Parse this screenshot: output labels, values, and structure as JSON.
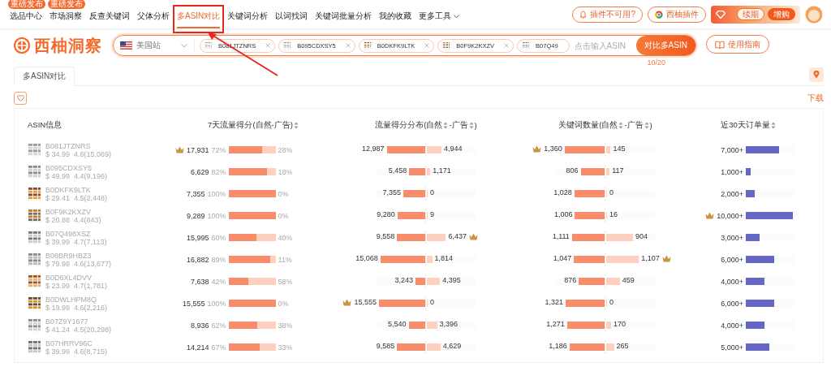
{
  "nav": {
    "items": [
      {
        "label": "选品中心",
        "badge": "重磅发布",
        "selected": false
      },
      {
        "label": "市场洞察",
        "badge": "重磅发布",
        "selected": false
      },
      {
        "label": "反查关键词",
        "selected": false
      },
      {
        "label": "父体分析",
        "selected": false
      },
      {
        "label": "多ASIN对比",
        "selected": true
      },
      {
        "label": "关键词分析",
        "selected": false
      },
      {
        "label": "以词找词",
        "selected": false
      },
      {
        "label": "关键词批量分析",
        "selected": false
      },
      {
        "label": "我的收藏",
        "selected": false
      },
      {
        "label": "更多工具",
        "dropdown": true,
        "selected": false
      }
    ],
    "actions": [
      {
        "kind": "alert",
        "label": "插件不可用?"
      },
      {
        "kind": "plugin",
        "label": "西柚插件"
      }
    ],
    "vip": {
      "renew": "续期",
      "buy": "增购"
    }
  },
  "brand": {
    "name": "西柚洞察"
  },
  "search": {
    "site": "美国站",
    "chips": [
      {
        "asin": "B081JTZNRS",
        "removable": true
      },
      {
        "asin": "B095CDXSY5",
        "removable": true
      },
      {
        "asin": "B0DKFK9LTK",
        "removable": true
      },
      {
        "asin": "B0F9K2KXZV",
        "removable": true
      },
      {
        "asin": "B07Q49",
        "removable": false
      }
    ],
    "placeholder": "点击输入ASIN",
    "button": "对比多ASIN",
    "count": "10/20"
  },
  "guide_button": "使用指南",
  "tabs": [
    {
      "label": "多ASIN对比",
      "selected": true
    }
  ],
  "download": "下载",
  "table": {
    "columns": [
      {
        "parts": [
          {
            "text": "ASIN信息"
          }
        ]
      },
      {
        "parts": [
          {
            "text": "7天流量得分(自然-广告)",
            "sortable": true
          }
        ]
      },
      {
        "parts": [
          {
            "text": "流量得分分布(自然",
            "sortable": true
          },
          {
            "text": "-广告",
            "sortable": true
          },
          {
            "text": ")"
          }
        ]
      },
      {
        "parts": [
          {
            "text": "关键词数量(自然",
            "sortable": true
          },
          {
            "text": "-广告",
            "sortable": true
          },
          {
            "text": ")"
          }
        ]
      },
      {
        "parts": [
          {
            "text": "近30天订单量",
            "sortable": true
          }
        ]
      }
    ],
    "rows": [
      {
        "asin": "B081JTZNRS",
        "price": "$ 34.99",
        "rating": "4.6(15,069)",
        "score": {
          "value": "17,931",
          "crown": true,
          "organic_pct": "72%",
          "ad_pct": "28%",
          "level": 0.72
        },
        "dist": {
          "organic": {
            "value": "12,987",
            "level": 0.79,
            "crown": false
          },
          "ad": {
            "value": "4,944",
            "level": 0.3,
            "crown": false
          }
        },
        "keywords": {
          "organic": {
            "value": "1,360",
            "level": 0.82,
            "crown": true
          },
          "ad": {
            "value": "145",
            "level": 0.09,
            "crown": false
          }
        },
        "orders": {
          "value": "7,000+",
          "level": 0.68,
          "crown": false
        }
      },
      {
        "asin": "B095CDXSY5",
        "price": "$ 49.99",
        "rating": "4.4(9,196)",
        "score": {
          "value": "6,629",
          "crown": false,
          "organic_pct": "82%",
          "ad_pct": "18%",
          "level": 0.82
        },
        "dist": {
          "organic": {
            "value": "5,458",
            "level": 0.33,
            "crown": false
          },
          "ad": {
            "value": "1,171",
            "level": 0.07,
            "crown": false
          }
        },
        "keywords": {
          "organic": {
            "value": "806",
            "level": 0.49,
            "crown": false
          },
          "ad": {
            "value": "117",
            "level": 0.07,
            "crown": false
          }
        },
        "orders": {
          "value": "1,000+",
          "level": 0.1,
          "crown": false
        }
      },
      {
        "asin": "B0DKFK9LTK",
        "price": "$ 29.41",
        "rating": "4.5(2,448)",
        "score": {
          "value": "7,355",
          "crown": false,
          "organic_pct": "100%",
          "ad_pct": "0%",
          "level": 1
        },
        "dist": {
          "organic": {
            "value": "7,355",
            "level": 0.45,
            "crown": false
          },
          "ad": {
            "value": "0",
            "level": 0,
            "crown": false
          }
        },
        "keywords": {
          "organic": {
            "value": "1,028",
            "level": 0.62,
            "crown": false
          },
          "ad": {
            "value": "0",
            "level": 0,
            "crown": false
          }
        },
        "orders": {
          "value": "2,000+",
          "level": 0.19,
          "crown": false
        }
      },
      {
        "asin": "B0F9K2KXZV",
        "price": "$ 20.88",
        "rating": "4.4(843)",
        "score": {
          "value": "9,289",
          "crown": false,
          "organic_pct": "100%",
          "ad_pct": "0%",
          "level": 1
        },
        "dist": {
          "organic": {
            "value": "9,280",
            "level": 0.57,
            "crown": false
          },
          "ad": {
            "value": "9",
            "level": 0,
            "crown": false
          }
        },
        "keywords": {
          "organic": {
            "value": "1,006",
            "level": 0.61,
            "crown": false
          },
          "ad": {
            "value": "16",
            "level": 0.01,
            "crown": false
          }
        },
        "orders": {
          "value": "10,000+",
          "level": 0.97,
          "crown": true
        }
      },
      {
        "asin": "B07Q498XSZ",
        "price": "$ 39.99",
        "rating": "4.7(7,113)",
        "score": {
          "value": "15,995",
          "crown": false,
          "organic_pct": "60%",
          "ad_pct": "40%",
          "level": 0.6
        },
        "dist": {
          "organic": {
            "value": "9,558",
            "level": 0.58,
            "crown": false
          },
          "ad": {
            "value": "6,437",
            "level": 0.39,
            "crown": true
          }
        },
        "keywords": {
          "organic": {
            "value": "1,111",
            "level": 0.67,
            "crown": false
          },
          "ad": {
            "value": "904",
            "level": 0.55,
            "crown": false
          }
        },
        "orders": {
          "value": "3,000+",
          "level": 0.29,
          "crown": false
        }
      },
      {
        "asin": "B08BR9HBZ3",
        "price": "$ 79.99",
        "rating": "4.6(13,677)",
        "score": {
          "value": "16,882",
          "crown": false,
          "organic_pct": "89%",
          "ad_pct": "11%",
          "level": 0.89
        },
        "dist": {
          "organic": {
            "value": "15,068",
            "level": 0.92,
            "crown": false
          },
          "ad": {
            "value": "1,814",
            "level": 0.11,
            "crown": false
          }
        },
        "keywords": {
          "organic": {
            "value": "1,047",
            "level": 0.63,
            "crown": false
          },
          "ad": {
            "value": "1,107",
            "level": 0.67,
            "crown": true
          }
        },
        "orders": {
          "value": "6,000+",
          "level": 0.58,
          "crown": false
        }
      },
      {
        "asin": "B0D6XL4DVV",
        "price": "$ 23.99",
        "rating": "4.7(1,781)",
        "score": {
          "value": "7,638",
          "crown": false,
          "organic_pct": "42%",
          "ad_pct": "58%",
          "level": 0.42
        },
        "dist": {
          "organic": {
            "value": "3,243",
            "level": 0.2,
            "crown": false
          },
          "ad": {
            "value": "4,395",
            "level": 0.27,
            "crown": false
          }
        },
        "keywords": {
          "organic": {
            "value": "876",
            "level": 0.53,
            "crown": false
          },
          "ad": {
            "value": "459",
            "level": 0.28,
            "crown": false
          }
        },
        "orders": {
          "value": "4,000+",
          "level": 0.39,
          "crown": false
        }
      },
      {
        "asin": "B0DWLHPM8Q",
        "price": "$ 19.99",
        "rating": "4.6(2,216)",
        "score": {
          "value": "15,555",
          "crown": false,
          "organic_pct": "100%",
          "ad_pct": "0%",
          "level": 1
        },
        "dist": {
          "organic": {
            "value": "15,555",
            "level": 0.95,
            "crown": true
          },
          "ad": {
            "value": "0",
            "level": 0,
            "crown": false
          }
        },
        "keywords": {
          "organic": {
            "value": "1,321",
            "level": 0.8,
            "crown": false
          },
          "ad": {
            "value": "0",
            "level": 0,
            "crown": false
          }
        },
        "orders": {
          "value": "6,000+",
          "level": 0.58,
          "crown": false
        }
      },
      {
        "asin": "B07Z9Y1677",
        "price": "$ 41.24",
        "rating": "4.5(20,298)",
        "score": {
          "value": "8,936",
          "crown": false,
          "organic_pct": "62%",
          "ad_pct": "38%",
          "level": 0.62
        },
        "dist": {
          "organic": {
            "value": "5,540",
            "level": 0.34,
            "crown": false
          },
          "ad": {
            "value": "3,396",
            "level": 0.21,
            "crown": false
          }
        },
        "keywords": {
          "organic": {
            "value": "1,271",
            "level": 0.77,
            "crown": false
          },
          "ad": {
            "value": "170",
            "level": 0.1,
            "crown": false
          }
        },
        "orders": {
          "value": "4,000+",
          "level": 0.39,
          "crown": false
        }
      },
      {
        "asin": "B07HRRV96C",
        "price": "$ 39.99",
        "rating": "4.6(8,715)",
        "score": {
          "value": "14,214",
          "crown": false,
          "organic_pct": "67%",
          "ad_pct": "33%",
          "level": 0.67
        },
        "dist": {
          "organic": {
            "value": "9,585",
            "level": 0.58,
            "crown": false
          },
          "ad": {
            "value": "4,629",
            "level": 0.28,
            "crown": false
          }
        },
        "keywords": {
          "organic": {
            "value": "1,186",
            "level": 0.72,
            "crown": false
          },
          "ad": {
            "value": "265",
            "level": 0.16,
            "crown": false
          }
        },
        "orders": {
          "value": "5,000+",
          "level": 0.49,
          "crown": false
        }
      }
    ]
  }
}
